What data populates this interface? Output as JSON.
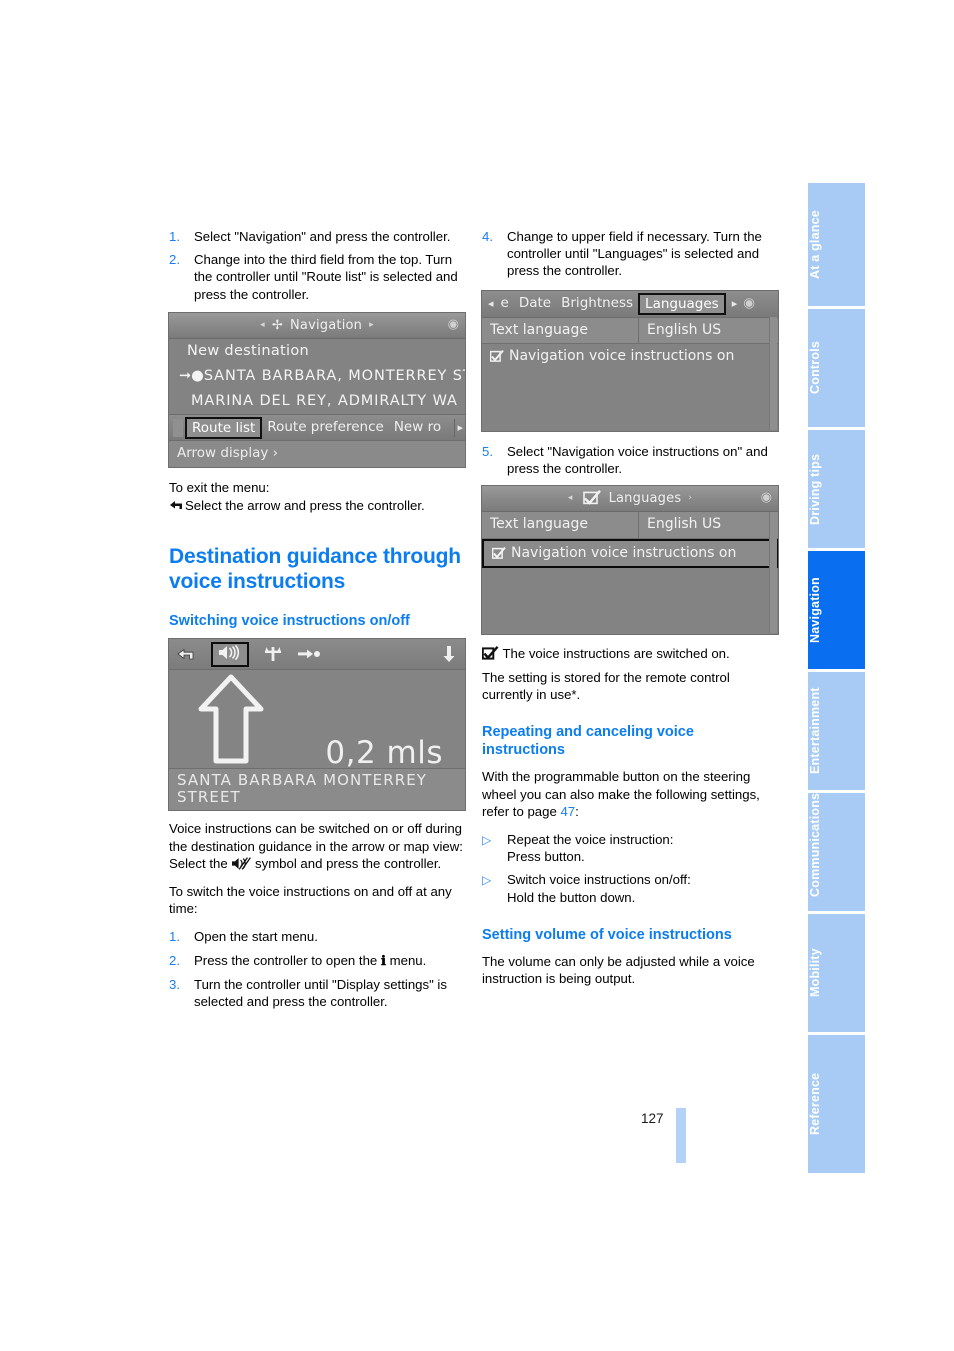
{
  "page": {
    "number": "127"
  },
  "sidebar": {
    "tabs": [
      {
        "label": "At a glance",
        "active": false
      },
      {
        "label": "Controls",
        "active": false
      },
      {
        "label": "Driving tips",
        "active": false
      },
      {
        "label": "Navigation",
        "active": true
      },
      {
        "label": "Entertainment",
        "active": false
      },
      {
        "label": "Communications",
        "active": false
      },
      {
        "label": "Mobility",
        "active": false
      },
      {
        "label": "Reference",
        "active": false
      }
    ],
    "active_color": "#0a6ef0",
    "inactive_color": "#a8cbf6"
  },
  "left_column": {
    "steps": [
      {
        "num": "1.",
        "text": "Select \"Navigation\" and press the controller."
      },
      {
        "num": "2.",
        "text": "Change into the third field from the top. Turn the controller until \"Route list\" is selected and press the controller."
      }
    ],
    "nav_screen": {
      "title": "Navigation",
      "left_arrow": "◂",
      "right_arrow": "▸",
      "title_icon": "navigation-compass-icon",
      "corner_icon": "joystick-icon",
      "rows": [
        "New destination",
        "SANTA BARBARA, MONTERREY ST",
        "MARINA DEL REY, ADMIRALTY WA"
      ],
      "row_marker": "➜●",
      "tabs": [
        {
          "label": "Route list",
          "selected": true
        },
        {
          "label": "Route preference",
          "selected": false
        },
        {
          "label": "New ro",
          "selected": false
        }
      ],
      "tab_edge_glyph": "▸",
      "footer": "Arrow display ›"
    },
    "exit_menu_label": "To exit the menu:",
    "exit_menu_text": "Select the arrow and press the controller.",
    "exit_menu_icon": "back-arrow-icon",
    "heading_main": "Destination guidance through voice instructions",
    "heading_sub_1": "Switching voice instructions on/off",
    "arrow_screen": {
      "toolbar_icons": [
        "back-arrow-icon",
        "speaker-on-icon",
        "junction-icon",
        "destination-flag-icon",
        "down-arrow-icon"
      ],
      "selected_icon": "speaker-on-icon",
      "distance": "0,2 mls",
      "direction": "straight-ahead-arrow",
      "street": "SANTA BARBARA MONTERREY STREET"
    },
    "body_1": "Voice instructions can be switched on or off during the destination guidance in the arrow or map view:",
    "body_2_prefix": "Select the",
    "body_2_icon": "speaker-muted-icon",
    "body_2_suffix": "symbol and press the controller.",
    "body_3": "To switch the voice instructions on and off at any time:",
    "steps_2": [
      {
        "num": "1.",
        "text": "Open the start menu."
      },
      {
        "num": "2.",
        "text_before": "Press the controller to open the",
        "icon": "info-i-icon",
        "text_after": "menu."
      },
      {
        "num": "3.",
        "text": "Turn the controller until \"Display settings\" is selected and press the controller."
      }
    ]
  },
  "right_column": {
    "step_4": {
      "num": "4.",
      "text": "Change to upper field if necessary. Turn the controller until \"Languages\" is selected and press the controller."
    },
    "settings_screen": {
      "tabs": [
        {
          "label": "e",
          "selected": false
        },
        {
          "label": "Date",
          "selected": false
        },
        {
          "label": "Brightness",
          "selected": false
        },
        {
          "label": "Languages",
          "selected": true
        }
      ],
      "left_edge_glyph": "◂",
      "right_edge_glyph": "▸",
      "corner_icon": "joystick-icon",
      "row_label": "Text language",
      "row_value": "English US",
      "checkbox_label": "Navigation voice instructions on",
      "checkbox_checked": true,
      "checkbox_row_selected": false
    },
    "step_5": {
      "num": "5.",
      "text": "Select \"Navigation voice instructions on\" and press the controller."
    },
    "languages_screen": {
      "title": "Languages",
      "left_arrow": "◂",
      "right_arrow": "›",
      "title_icon": "checkbox-check-icon",
      "corner_icon": "joystick-icon",
      "row_label": "Text language",
      "row_value": "English US",
      "checkbox_label": "Navigation voice instructions on",
      "checkbox_checked": true,
      "checkbox_row_selected": true
    },
    "note_icon": "checkbox-check-icon",
    "note_text": "The voice instructions are switched on.",
    "note_body": "The setting is stored for the remote control currently in use*.",
    "heading_sub_2": "Repeating and canceling voice instructions",
    "body_1_before": "With the programmable button on the steering wheel you can also make the following settings, refer to page",
    "body_1_link": "47",
    "body_1_after": ":",
    "bullets": [
      {
        "marker": "▷",
        "line1": "Repeat the voice instruction:",
        "line2": "Press button."
      },
      {
        "marker": "▷",
        "line1": "Switch voice instructions on/off:",
        "line2": "Hold the button down."
      }
    ],
    "heading_sub_3": "Setting volume of voice instructions",
    "body_2": "The volume can only be adjusted while a voice instruction is being output."
  }
}
